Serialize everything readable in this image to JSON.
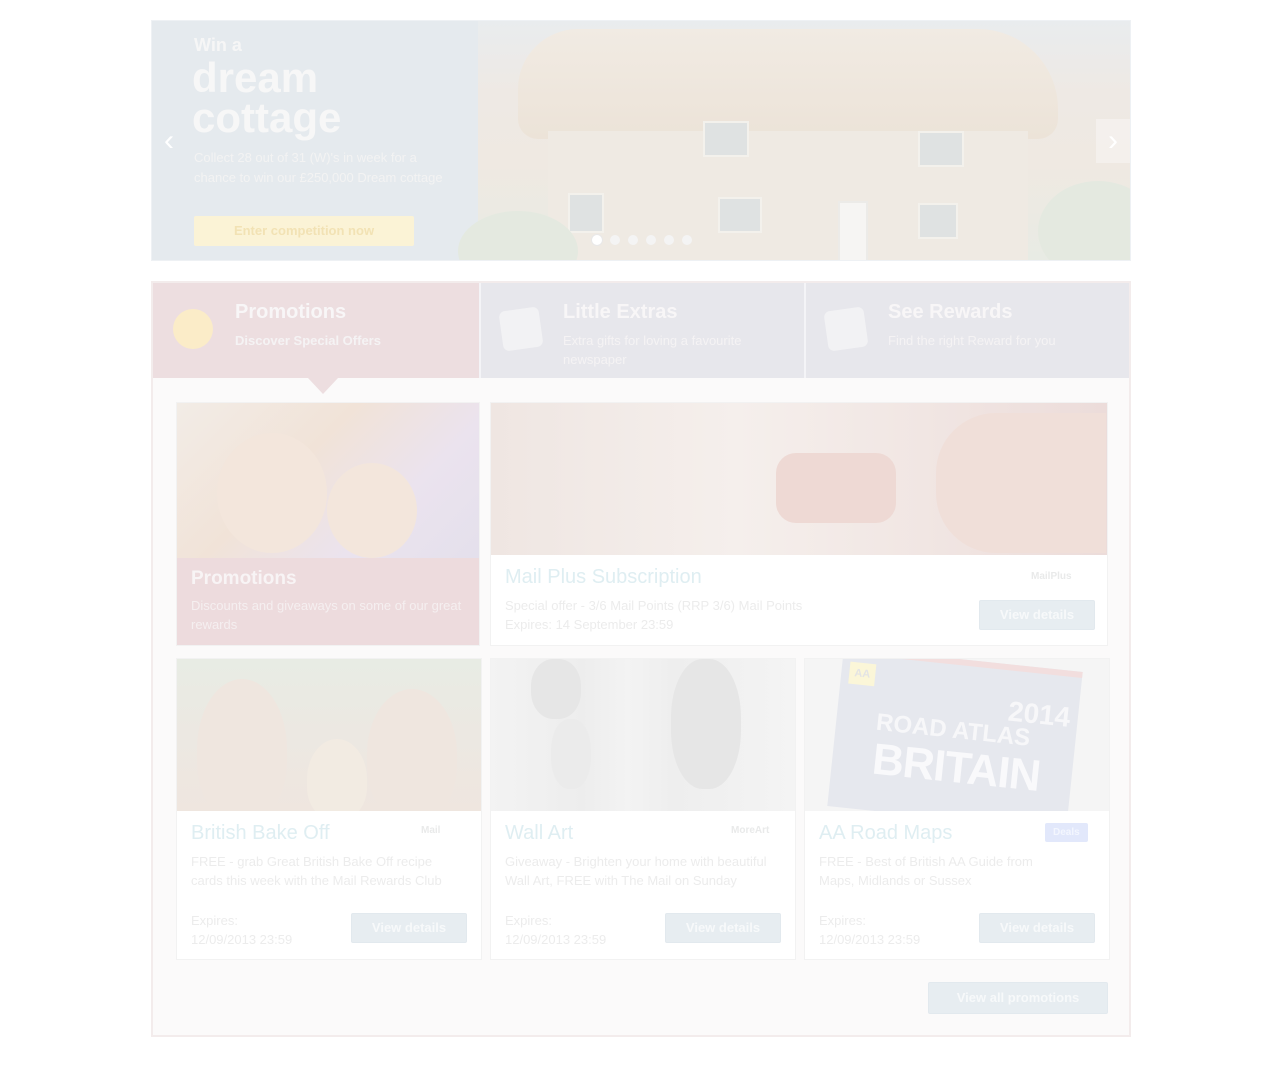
{
  "hero": {
    "small_heading": "Win a",
    "title_line1": "dream",
    "title_line2": "cottage",
    "description": "Collect 28 out of 31 (W)'s in week for a chance to win our £250,000 Dream cottage",
    "cta_label": "Enter competition now",
    "prev_icon": "chevron-left-icon",
    "next_icon": "chevron-right-icon",
    "prev_glyph": "‹",
    "next_glyph": "›",
    "slide_count": 6,
    "active_slide": 1
  },
  "tabs": [
    {
      "title": "Promotions",
      "subtitle": "Discover Special Offers",
      "icon": "star-badge-icon",
      "active": true
    },
    {
      "title": "Little Extras",
      "subtitle": "Extra gifts for loving a favourite newspaper",
      "icon": "gift-tag-icon",
      "active": false
    },
    {
      "title": "See Rewards",
      "subtitle": "Find the right Reward for you",
      "icon": "rewards-tag-icon",
      "active": false
    }
  ],
  "promo_card": {
    "title": "Promotions",
    "description": "Discounts and giveaways on some of our great rewards"
  },
  "featured": {
    "title": "Mail Plus Subscription",
    "brand": "MailPlus",
    "description": "Special offer - 3/6 Mail Points (RRP 3/6) Mail Points",
    "expires": "Expires: 14 September 23:59",
    "button": "View details"
  },
  "cards": [
    {
      "title": "British Bake Off",
      "brand": "Mail",
      "description": "FREE - grab Great British Bake Off recipe cards this week with the Mail Rewards Club",
      "expires_label": "Expires:",
      "expires_value": "12/09/2013 23:59",
      "button": "View details"
    },
    {
      "title": "Wall Art",
      "brand": "MoreArt",
      "description": "Giveaway - Brighten your home with beautiful Wall Art, FREE with The Mail on Sunday",
      "expires_label": "Expires:",
      "expires_value": "12/09/2013 23:59",
      "button": "View details"
    },
    {
      "title": "AA Road Maps",
      "brand": "Deals",
      "description": "FREE - Best of British AA Guide from Maps, Midlands or Sussex",
      "expires_label": "Expires:",
      "expires_value": "12/09/2013 23:59",
      "button": "View details"
    }
  ],
  "atlas": {
    "logo": "AA",
    "year": "2014",
    "line1": "ROAD ATLAS",
    "line2": "BRITAIN"
  },
  "view_all": "View all promotions",
  "colors": {
    "accent_link": "#dfeef2",
    "button_bg": "#e7edf1",
    "promo_tab_bg": "#eddee0",
    "tab_bg": "#e7e7ec"
  }
}
